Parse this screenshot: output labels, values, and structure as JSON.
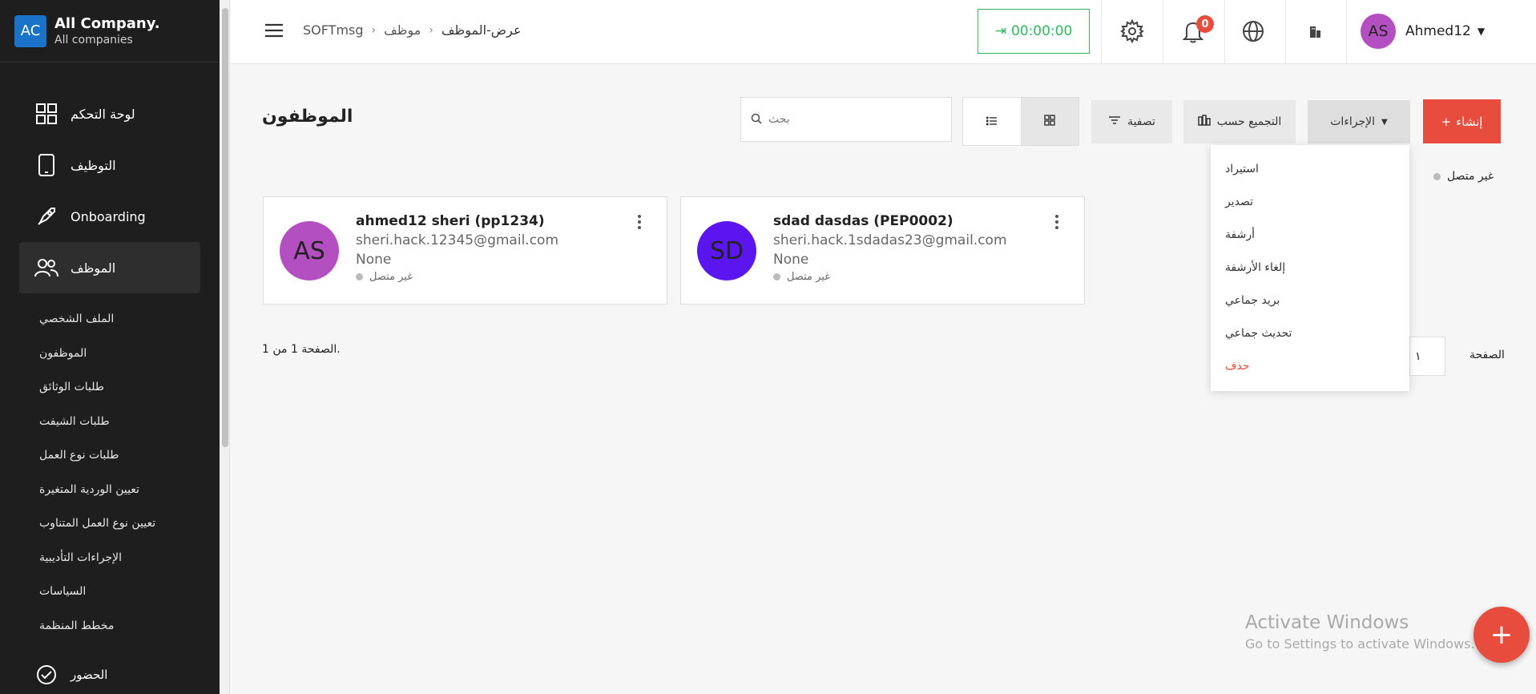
{
  "company": {
    "logo": "AC",
    "name": "All Company.",
    "subtitle": "All companies"
  },
  "sidebar": {
    "items": [
      {
        "label": "لوحة التحكم",
        "icon": "dashboard-icon"
      },
      {
        "label": "التوظيف",
        "icon": "phone-icon"
      },
      {
        "label": "Onboarding",
        "icon": "rocket-icon"
      },
      {
        "label": "الموظف",
        "icon": "users-icon",
        "active": true
      }
    ],
    "subitems": [
      "الملف الشخصي",
      "الموظفون",
      "طلبات الوثائق",
      "طلبات الشيفت",
      "طلبات نوع العمل",
      "تعيين الوردية المتغيرة",
      "تعيين نوع العمل المتناوب",
      "الإجراءات التأديبية",
      "السياسات",
      "مخطط المنظمة"
    ],
    "bottom_item": {
      "label": "الحضور",
      "icon": "check-circle-icon"
    }
  },
  "header": {
    "breadcrumb": [
      "SOFTmsg",
      "موظف",
      "عرض-الموظف"
    ],
    "timer": "00:00:00",
    "notifications_count": "0",
    "user": {
      "initials": "AS",
      "name": "Ahmed12"
    }
  },
  "page": {
    "title": "الموظفون",
    "search_placeholder": "بحث",
    "buttons": {
      "create": "إنشاء",
      "actions": "الإجراءات",
      "group_by": "التجميع حسب",
      "filter": "تصفية"
    },
    "status_filter": "غير متصل",
    "actions_menu": [
      "استيراد",
      "تصدير",
      "أرشفة",
      "إلغاء الأرشفة",
      "بريد جماعي",
      "تحديث جماعي",
      "حذف"
    ],
    "employees": [
      {
        "initials": "AS",
        "name": "ahmed12 sheri (pp1234)",
        "email": "sheri.hack.12345@gmail.com",
        "dept": "None",
        "status": "غير متصل",
        "color": "#b34fc0"
      },
      {
        "initials": "SD",
        "name": "sdad dasdas (PEP0002)",
        "email": "sheri.hack.1sdadas23@gmail.com",
        "dept": "None",
        "status": "غير متصل",
        "color": "#5b16f0"
      }
    ],
    "page_count": "الصفحة 1 من 1.",
    "pager_label": "الصفحة",
    "pager_value": "١"
  },
  "watermark": {
    "line1": "Activate Windows",
    "line2": "Go to Settings to activate Windows."
  },
  "colors": {
    "accent": "#e74c3c",
    "timer": "#2eb85c",
    "sidebar": "#1e1e1e"
  }
}
